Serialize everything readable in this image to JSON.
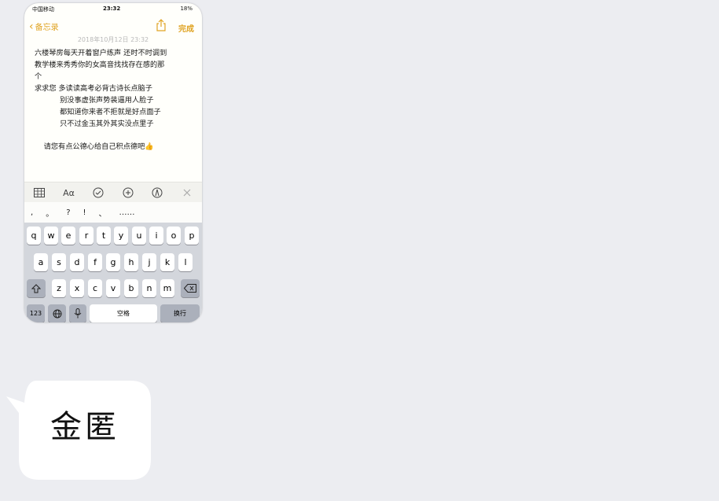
{
  "status": {
    "carrier": "中国移动",
    "time": "23:32",
    "battery": "18%"
  },
  "nav": {
    "back_label": "备忘录",
    "done_label": "完成"
  },
  "note": {
    "date": "2018年10月12日 23:32",
    "lines": [
      "六楼琴房每天开着窗户练声 还时不时调到",
      "教学楼来秀秀你的女高音找找存在感的那",
      "个",
      "求求您 多读读高考必背古诗长点脑子",
      "           别没事虚张声势装逼用人脸子",
      "           都知道你来者不拒就是好点面子",
      "           只不过金玉其外其实没点里子",
      "",
      "    请您有点公德心给自己积点德吧👍"
    ]
  },
  "toolbar": {
    "table_icon": "table-icon",
    "format_label": "Aα",
    "check_icon": "checklist-icon",
    "add_icon": "plus-circle-icon",
    "markup_icon": "markup-pen-icon",
    "close_icon": "close-icon"
  },
  "punctuation": [
    ",",
    "。",
    "?",
    "!",
    "、",
    "……"
  ],
  "keyboard": {
    "row1": [
      "q",
      "w",
      "e",
      "r",
      "t",
      "y",
      "u",
      "i",
      "o",
      "p"
    ],
    "row2": [
      "a",
      "s",
      "d",
      "f",
      "g",
      "h",
      "j",
      "k",
      "l"
    ],
    "row3": [
      "z",
      "x",
      "c",
      "v",
      "b",
      "n",
      "m"
    ],
    "numbers_label": "123",
    "space_label": "空格",
    "return_label": "换行"
  },
  "bubble": {
    "text": "金匿"
  }
}
